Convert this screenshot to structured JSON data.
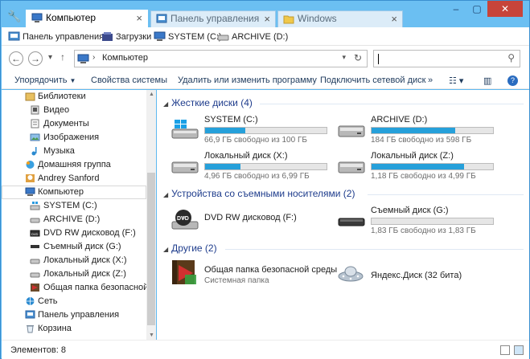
{
  "tabs": [
    {
      "label": "Компьютер",
      "icon": "computer-icon",
      "active": true
    },
    {
      "label": "Панель управления",
      "icon": "control-panel-icon",
      "active": false
    },
    {
      "label": "Windows",
      "icon": "folder-icon",
      "active": false
    }
  ],
  "bookmarks": [
    {
      "label": "Панель управления",
      "icon": "control-panel-icon"
    },
    {
      "label": "Загрузки",
      "icon": "downloads-icon"
    },
    {
      "label": "SYSTEM (C:)",
      "icon": "computer-icon"
    },
    {
      "label": "ARCHIVE (D:)",
      "icon": "drive-icon"
    }
  ],
  "address": {
    "path": "Компьютер",
    "search_value": ""
  },
  "commands": {
    "organize": "Упорядочить",
    "system_props": "Свойства системы",
    "uninstall": "Удалить или изменить программу",
    "map_drive": "Подключить сетевой диск",
    "more": "»"
  },
  "tree": [
    {
      "label": "Библиотеки",
      "indent": 1
    },
    {
      "label": "Видео",
      "indent": 2
    },
    {
      "label": "Документы",
      "indent": 2
    },
    {
      "label": "Изображения",
      "indent": 2
    },
    {
      "label": "Музыка",
      "indent": 2
    },
    {
      "label": "Домашняя группа",
      "indent": 1
    },
    {
      "label": "Andrey Sanford",
      "indent": 1
    },
    {
      "label": "Компьютер",
      "indent": 1,
      "selected": true
    },
    {
      "label": "SYSTEM (C:)",
      "indent": 2
    },
    {
      "label": "ARCHIVE (D:)",
      "indent": 2
    },
    {
      "label": "DVD RW дисковод (F:)",
      "indent": 2
    },
    {
      "label": "Съемный диск (G:)",
      "indent": 2
    },
    {
      "label": "Локальный диск (X:)",
      "indent": 2
    },
    {
      "label": "Локальный диск (Z:)",
      "indent": 2
    },
    {
      "label": "Общая папка безопасной ср",
      "indent": 2
    },
    {
      "label": "Сеть",
      "indent": 1
    },
    {
      "label": "Панель управления",
      "indent": 1
    },
    {
      "label": "Корзина",
      "indent": 1
    }
  ],
  "groups": {
    "hard_disks": "Жесткие диски (4)",
    "removable": "Устройства со съемными носителями (2)",
    "other": "Другие (2)"
  },
  "drives": [
    {
      "name": "SYSTEM (C:)",
      "free_text": "66,9 ГБ свободно из 100 ГБ",
      "used_fraction": 0.33
    },
    {
      "name": "ARCHIVE (D:)",
      "free_text": "184 ГБ свободно из 598 ГБ",
      "used_fraction": 0.69
    },
    {
      "name": "Локальный диск (X:)",
      "free_text": "4,96 ГБ свободно из 6,99 ГБ",
      "used_fraction": 0.29
    },
    {
      "name": "Локальный диск (Z:)",
      "free_text": "1,18 ГБ свободно из 4,99 ГБ",
      "used_fraction": 0.76
    }
  ],
  "removable": [
    {
      "name": "DVD RW дисковод (F:)"
    },
    {
      "name": "Съемный диск (G:)",
      "free_text": "1,83 ГБ свободно из 1,83 ГБ",
      "used_fraction": 0.0
    }
  ],
  "other": [
    {
      "name": "Общая папка безопасной среды",
      "sub": "Системная папка"
    },
    {
      "name": "Яндекс.Диск (32 бита)"
    }
  ],
  "status": {
    "items": "Элементов: 8"
  },
  "colors": {
    "titlebar": "#6bbff2",
    "accent": "#26a0da",
    "group_text": "#1e3c8c",
    "close": "#c7443a"
  }
}
